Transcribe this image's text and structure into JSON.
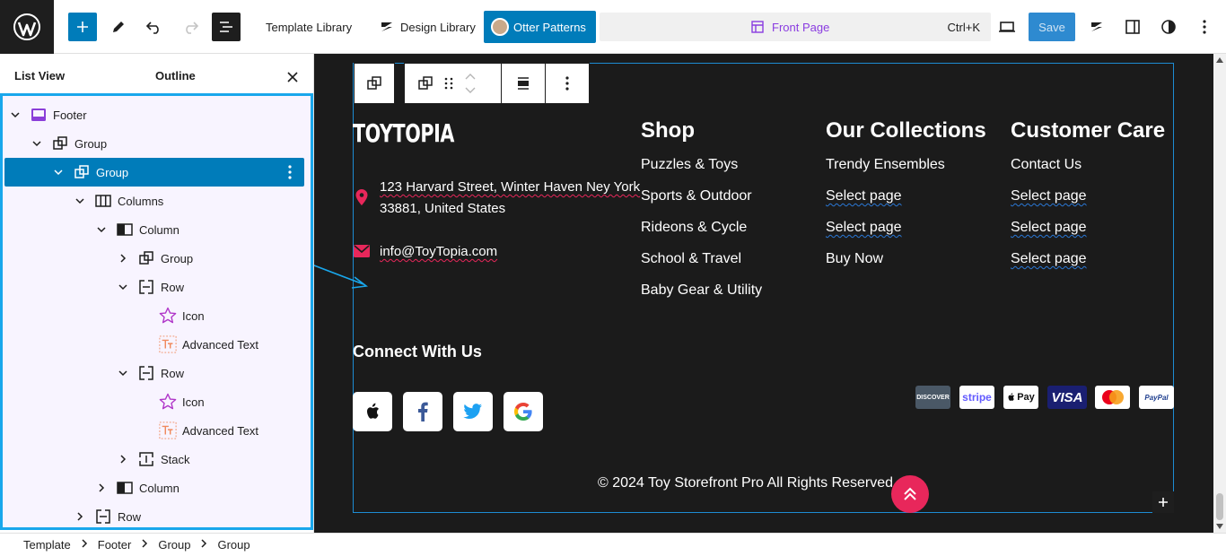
{
  "toolbar": {
    "template_library": "Template Library",
    "design_library": "Design Library",
    "otter_patterns": "Otter Patterns",
    "command_title": "Front Page",
    "command_shortcut": "Ctrl+K",
    "save": "Save"
  },
  "panel": {
    "tab_list_view": "List View",
    "tab_outline": "Outline"
  },
  "tree": [
    {
      "label": "Footer",
      "icon": "footer-template-icon",
      "depth": 0,
      "chevron": "down"
    },
    {
      "label": "Group",
      "icon": "group-icon",
      "depth": 1,
      "chevron": "down"
    },
    {
      "label": "Group",
      "icon": "group-icon",
      "depth": 2,
      "chevron": "down",
      "selected": true
    },
    {
      "label": "Columns",
      "icon": "columns-icon",
      "depth": 3,
      "chevron": "down"
    },
    {
      "label": "Column",
      "icon": "column-icon",
      "depth": 4,
      "chevron": "down"
    },
    {
      "label": "Group",
      "icon": "group-icon",
      "depth": 5,
      "chevron": "right"
    },
    {
      "label": "Row",
      "icon": "row-icon",
      "depth": 5,
      "chevron": "down"
    },
    {
      "label": "Icon",
      "icon": "star-icon",
      "depth": 6,
      "chevron": ""
    },
    {
      "label": "Advanced Text",
      "icon": "advanced-text-icon",
      "depth": 6,
      "chevron": ""
    },
    {
      "label": "Row",
      "icon": "row-icon",
      "depth": 5,
      "chevron": "down"
    },
    {
      "label": "Icon",
      "icon": "star-icon",
      "depth": 6,
      "chevron": ""
    },
    {
      "label": "Advanced Text",
      "icon": "advanced-text-icon",
      "depth": 6,
      "chevron": ""
    },
    {
      "label": "Stack",
      "icon": "stack-icon",
      "depth": 5,
      "chevron": "right"
    },
    {
      "label": "Column",
      "icon": "column-icon",
      "depth": 4,
      "chevron": "right"
    },
    {
      "label": "Row",
      "icon": "row-icon",
      "depth": 3,
      "chevron": "right"
    }
  ],
  "footer": {
    "brand": "TOYTOPIA",
    "address_line1": "123 Harvard Street, Winter Haven Ney York",
    "address_line2": "33881, United States",
    "email": "info@ToyTopia.com",
    "columns": [
      {
        "title": "Shop",
        "links": [
          "Puzzles & Toys",
          "Sports & Outdoor",
          "Rideons & Cycle",
          "School & Travel",
          "Baby Gear & Utility"
        ]
      },
      {
        "title": "Our Collections",
        "links": [
          "Trendy Ensembles",
          "Select page",
          "Select page",
          "Buy Now"
        ]
      },
      {
        "title": "Customer Care",
        "links": [
          "Contact Us",
          "Select page",
          "Select page",
          "Select page"
        ]
      }
    ],
    "connect_title": "Connect With Us",
    "payments": [
      "DISCOVER",
      "stripe",
      "Pay",
      "VISA",
      "mastercard",
      "PayPal"
    ],
    "copyright": "© 2024 Toy Storefront Pro All Rights Reserved."
  },
  "breadcrumbs": [
    "Template",
    "Footer",
    "Group",
    "Group"
  ],
  "colors": {
    "accent": "#007cba",
    "canvas_bg": "#1b1b1b",
    "brand_pink": "#e8275b",
    "tree_bg": "#f8f4ff"
  }
}
